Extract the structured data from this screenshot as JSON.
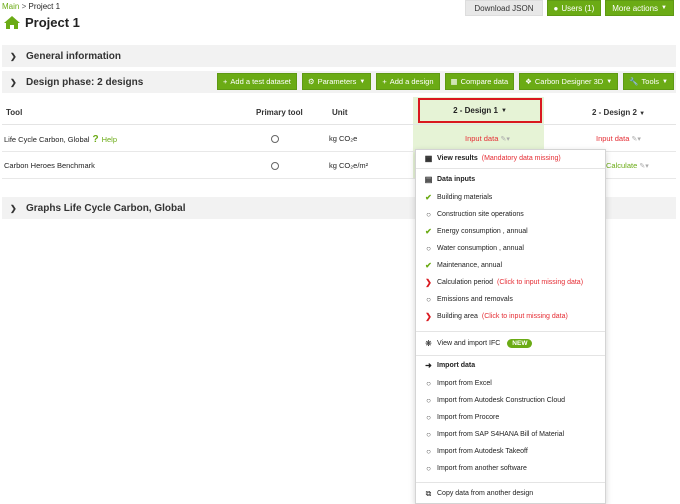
{
  "breadcrumb": {
    "main": "Main",
    "separator": ">",
    "current": "Project 1"
  },
  "top_actions": {
    "download": "Download JSON",
    "users": "Users (1)",
    "more": "More actions"
  },
  "page": {
    "title": "Project 1"
  },
  "sections": {
    "general": "General information",
    "design_phase": "Design phase: 2 designs",
    "graphs": "Graphs Life Cycle Carbon, Global"
  },
  "toolbar": {
    "add_test": "Add a test dataset",
    "parameters": "Parameters",
    "add_design": "Add a design",
    "compare": "Compare data",
    "carbon3d": "Carbon Designer 3D",
    "tools": "Tools"
  },
  "table": {
    "headers": {
      "tool": "Tool",
      "primary": "Primary tool",
      "unit": "Unit",
      "design1": "2 - Design 1",
      "design2": "2 - Design 2"
    },
    "rows": [
      {
        "tool": "Life Cycle Carbon, Global",
        "help": "Help",
        "unit": "kg CO₂e",
        "d1": "Input data",
        "d2": "Input data"
      },
      {
        "tool": "Carbon Heroes Benchmark",
        "unit": "kg CO₂e/m²",
        "d2": "Calculate"
      }
    ]
  },
  "dropdown": {
    "view_results": "View results",
    "view_results_note": "(Mandatory data missing)",
    "data_inputs": "Data inputs",
    "inputs": [
      {
        "label": "Building materials",
        "status": "done"
      },
      {
        "label": "Construction site operations",
        "status": "optional"
      },
      {
        "label": "Energy consumption , annual",
        "status": "done"
      },
      {
        "label": "Water consumption , annual",
        "status": "optional"
      },
      {
        "label": "Maintenance, annual",
        "status": "done"
      },
      {
        "label": "Calculation period",
        "status": "missing",
        "note": "(Click to input missing data)"
      },
      {
        "label": "Emissions and removals",
        "status": "optional"
      },
      {
        "label": "Building area",
        "status": "missing",
        "note": "(Click to input missing data)"
      }
    ],
    "ifc": "View and import IFC",
    "new_badge": "NEW",
    "import_title": "Import data",
    "imports": [
      "Import from Excel",
      "Import from Autodesk Construction Cloud",
      "Import from Procore",
      "Import from SAP S4HANA Bill of Material",
      "Import from Autodesk Takeoff",
      "Import from another software"
    ],
    "copy": "Copy data from another design"
  },
  "colors": {
    "brand_green": "#6bab15",
    "alert_red": "#d9181f",
    "highlight_bg": "#e6f3d6"
  }
}
